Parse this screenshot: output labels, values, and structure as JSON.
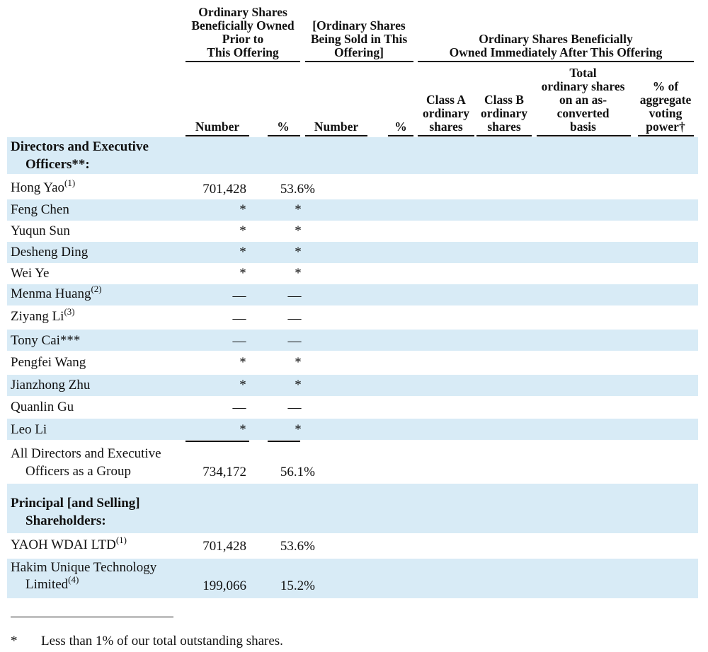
{
  "header": {
    "group1": "Ordinary Shares Beneficially Owned Prior to This Offering",
    "group1_lines": [
      "Ordinary Shares",
      "Beneficially Owned",
      "Prior to",
      "This Offering"
    ],
    "group2_lines": [
      "[Ordinary Shares",
      "Being Sold in This",
      "Offering]"
    ],
    "group3_lines": [
      "Ordinary Shares Beneficially",
      "Owned Immediately After This Offering"
    ],
    "col_number": "Number",
    "col_pct": "%",
    "col_number2": "Number",
    "col_pct2": "%",
    "col_classA": [
      "Class A",
      "ordinary",
      "shares"
    ],
    "col_classB": [
      "Class B",
      "ordinary",
      "shares"
    ],
    "col_total": [
      "Total",
      "ordinary shares",
      "on an as-",
      "converted",
      "basis"
    ],
    "col_voting": [
      "% of",
      "aggregate",
      "voting",
      "power†"
    ]
  },
  "section1": {
    "line1": "Directors and Executive",
    "line2": "Officers**:"
  },
  "rows": [
    {
      "name": "Hong Yao",
      "sup": "(1)",
      "number": "701,428",
      "pct": "53.6%"
    },
    {
      "name": "Feng Chen",
      "sup": "",
      "number": "*",
      "pct": "*"
    },
    {
      "name": "Yuqun Sun",
      "sup": "",
      "number": "*",
      "pct": "*"
    },
    {
      "name": "Desheng Ding",
      "sup": "",
      "number": "*",
      "pct": "*"
    },
    {
      "name": "Wei Ye",
      "sup": "",
      "number": "*",
      "pct": "*"
    },
    {
      "name": "Menma Huang",
      "sup": "(2)",
      "number": "—",
      "pct": "—"
    },
    {
      "name": "Ziyang Li",
      "sup": "(3)",
      "number": "—",
      "pct": "—"
    },
    {
      "name": "Tony Cai***",
      "sup": "",
      "number": "—",
      "pct": "—"
    },
    {
      "name": "Pengfei Wang",
      "sup": "",
      "number": "*",
      "pct": "*"
    },
    {
      "name": "Jianzhong Zhu",
      "sup": "",
      "number": "*",
      "pct": "*"
    },
    {
      "name": "Quanlin Gu",
      "sup": "",
      "number": "—",
      "pct": "—"
    },
    {
      "name": "Leo Li",
      "sup": "",
      "number": "*",
      "pct": "*"
    }
  ],
  "group_total": {
    "line1": "All Directors and Executive",
    "line2": "Officers as a Group",
    "number": "734,172",
    "pct": "56.1%"
  },
  "section2": {
    "line1": "Principal [and Selling]",
    "line2": "Shareholders:"
  },
  "principal": [
    {
      "name": "YAOH WDAI LTD",
      "sup": "(1)",
      "number": "701,428",
      "pct": "53.6%"
    },
    {
      "line1": "Hakim Unique Technology",
      "line2": "Limited",
      "sup": "(4)",
      "number": "199,066",
      "pct": "15.2%"
    }
  ],
  "footnote": {
    "mark": "*",
    "text": "Less than 1% of our total outstanding shares."
  }
}
